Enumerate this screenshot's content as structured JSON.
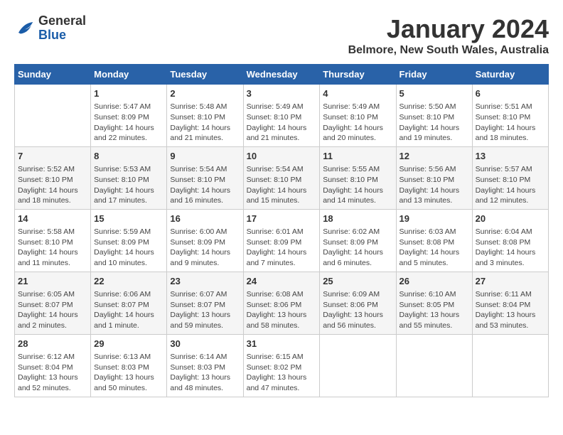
{
  "logo": {
    "line1": "General",
    "line2": "Blue"
  },
  "title": "January 2024",
  "subtitle": "Belmore, New South Wales, Australia",
  "days_header": [
    "Sunday",
    "Monday",
    "Tuesday",
    "Wednesday",
    "Thursday",
    "Friday",
    "Saturday"
  ],
  "weeks": [
    [
      {
        "num": "",
        "info": ""
      },
      {
        "num": "1",
        "info": "Sunrise: 5:47 AM\nSunset: 8:09 PM\nDaylight: 14 hours\nand 22 minutes."
      },
      {
        "num": "2",
        "info": "Sunrise: 5:48 AM\nSunset: 8:10 PM\nDaylight: 14 hours\nand 21 minutes."
      },
      {
        "num": "3",
        "info": "Sunrise: 5:49 AM\nSunset: 8:10 PM\nDaylight: 14 hours\nand 21 minutes."
      },
      {
        "num": "4",
        "info": "Sunrise: 5:49 AM\nSunset: 8:10 PM\nDaylight: 14 hours\nand 20 minutes."
      },
      {
        "num": "5",
        "info": "Sunrise: 5:50 AM\nSunset: 8:10 PM\nDaylight: 14 hours\nand 19 minutes."
      },
      {
        "num": "6",
        "info": "Sunrise: 5:51 AM\nSunset: 8:10 PM\nDaylight: 14 hours\nand 18 minutes."
      }
    ],
    [
      {
        "num": "7",
        "info": "Sunrise: 5:52 AM\nSunset: 8:10 PM\nDaylight: 14 hours\nand 18 minutes."
      },
      {
        "num": "8",
        "info": "Sunrise: 5:53 AM\nSunset: 8:10 PM\nDaylight: 14 hours\nand 17 minutes."
      },
      {
        "num": "9",
        "info": "Sunrise: 5:54 AM\nSunset: 8:10 PM\nDaylight: 14 hours\nand 16 minutes."
      },
      {
        "num": "10",
        "info": "Sunrise: 5:54 AM\nSunset: 8:10 PM\nDaylight: 14 hours\nand 15 minutes."
      },
      {
        "num": "11",
        "info": "Sunrise: 5:55 AM\nSunset: 8:10 PM\nDaylight: 14 hours\nand 14 minutes."
      },
      {
        "num": "12",
        "info": "Sunrise: 5:56 AM\nSunset: 8:10 PM\nDaylight: 14 hours\nand 13 minutes."
      },
      {
        "num": "13",
        "info": "Sunrise: 5:57 AM\nSunset: 8:10 PM\nDaylight: 14 hours\nand 12 minutes."
      }
    ],
    [
      {
        "num": "14",
        "info": "Sunrise: 5:58 AM\nSunset: 8:10 PM\nDaylight: 14 hours\nand 11 minutes."
      },
      {
        "num": "15",
        "info": "Sunrise: 5:59 AM\nSunset: 8:09 PM\nDaylight: 14 hours\nand 10 minutes."
      },
      {
        "num": "16",
        "info": "Sunrise: 6:00 AM\nSunset: 8:09 PM\nDaylight: 14 hours\nand 9 minutes."
      },
      {
        "num": "17",
        "info": "Sunrise: 6:01 AM\nSunset: 8:09 PM\nDaylight: 14 hours\nand 7 minutes."
      },
      {
        "num": "18",
        "info": "Sunrise: 6:02 AM\nSunset: 8:09 PM\nDaylight: 14 hours\nand 6 minutes."
      },
      {
        "num": "19",
        "info": "Sunrise: 6:03 AM\nSunset: 8:08 PM\nDaylight: 14 hours\nand 5 minutes."
      },
      {
        "num": "20",
        "info": "Sunrise: 6:04 AM\nSunset: 8:08 PM\nDaylight: 14 hours\nand 3 minutes."
      }
    ],
    [
      {
        "num": "21",
        "info": "Sunrise: 6:05 AM\nSunset: 8:07 PM\nDaylight: 14 hours\nand 2 minutes."
      },
      {
        "num": "22",
        "info": "Sunrise: 6:06 AM\nSunset: 8:07 PM\nDaylight: 14 hours\nand 1 minute."
      },
      {
        "num": "23",
        "info": "Sunrise: 6:07 AM\nSunset: 8:07 PM\nDaylight: 13 hours\nand 59 minutes."
      },
      {
        "num": "24",
        "info": "Sunrise: 6:08 AM\nSunset: 8:06 PM\nDaylight: 13 hours\nand 58 minutes."
      },
      {
        "num": "25",
        "info": "Sunrise: 6:09 AM\nSunset: 8:06 PM\nDaylight: 13 hours\nand 56 minutes."
      },
      {
        "num": "26",
        "info": "Sunrise: 6:10 AM\nSunset: 8:05 PM\nDaylight: 13 hours\nand 55 minutes."
      },
      {
        "num": "27",
        "info": "Sunrise: 6:11 AM\nSunset: 8:04 PM\nDaylight: 13 hours\nand 53 minutes."
      }
    ],
    [
      {
        "num": "28",
        "info": "Sunrise: 6:12 AM\nSunset: 8:04 PM\nDaylight: 13 hours\nand 52 minutes."
      },
      {
        "num": "29",
        "info": "Sunrise: 6:13 AM\nSunset: 8:03 PM\nDaylight: 13 hours\nand 50 minutes."
      },
      {
        "num": "30",
        "info": "Sunrise: 6:14 AM\nSunset: 8:03 PM\nDaylight: 13 hours\nand 48 minutes."
      },
      {
        "num": "31",
        "info": "Sunrise: 6:15 AM\nSunset: 8:02 PM\nDaylight: 13 hours\nand 47 minutes."
      },
      {
        "num": "",
        "info": ""
      },
      {
        "num": "",
        "info": ""
      },
      {
        "num": "",
        "info": ""
      }
    ]
  ]
}
